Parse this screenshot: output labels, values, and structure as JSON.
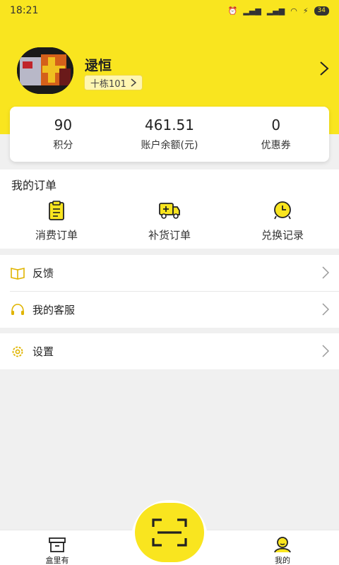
{
  "status_bar": {
    "time": "18:21",
    "battery": "34"
  },
  "profile": {
    "name": "逯恒",
    "room": "十栋101"
  },
  "stats": [
    {
      "value": "90",
      "label": "积分"
    },
    {
      "value": "461.51",
      "label": "账户余额(元)"
    },
    {
      "value": "0",
      "label": "优惠券"
    }
  ],
  "orders": {
    "title": "我的订单",
    "items": [
      {
        "label": "消费订单",
        "icon": "clipboard-icon"
      },
      {
        "label": "补货订单",
        "icon": "truck-icon"
      },
      {
        "label": "兑换记录",
        "icon": "clock-icon"
      }
    ]
  },
  "menu": {
    "feedback": "反馈",
    "service": "我的客服",
    "settings": "设置"
  },
  "nav": {
    "home": "盒里有",
    "mine": "我的"
  },
  "colors": {
    "brand_yellow": "#f9e51f",
    "icon_gold": "#e0b400"
  }
}
